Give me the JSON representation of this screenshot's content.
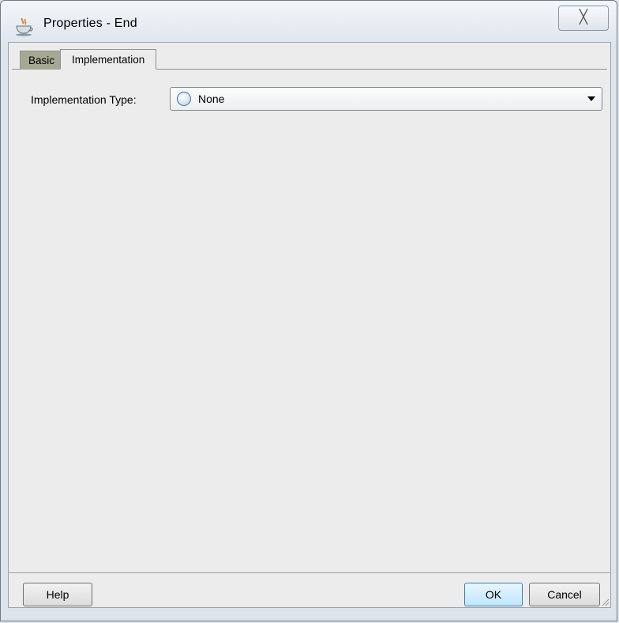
{
  "window": {
    "title": "Properties - End",
    "close_glyph": "╳",
    "icon": "java-cup-icon"
  },
  "tabs": [
    {
      "label": "Basic",
      "active": false
    },
    {
      "label": "Implementation",
      "active": true
    }
  ],
  "implementation": {
    "label": "Implementation Type:",
    "selected_value": "None",
    "selected_icon": "none-circle-icon"
  },
  "buttons": {
    "help": "Help",
    "ok": "OK",
    "cancel": "Cancel"
  },
  "colors": {
    "inactive_tab": "#a7a894",
    "panel_bg": "#ececec",
    "default_button_border": "#3c7fb1"
  }
}
